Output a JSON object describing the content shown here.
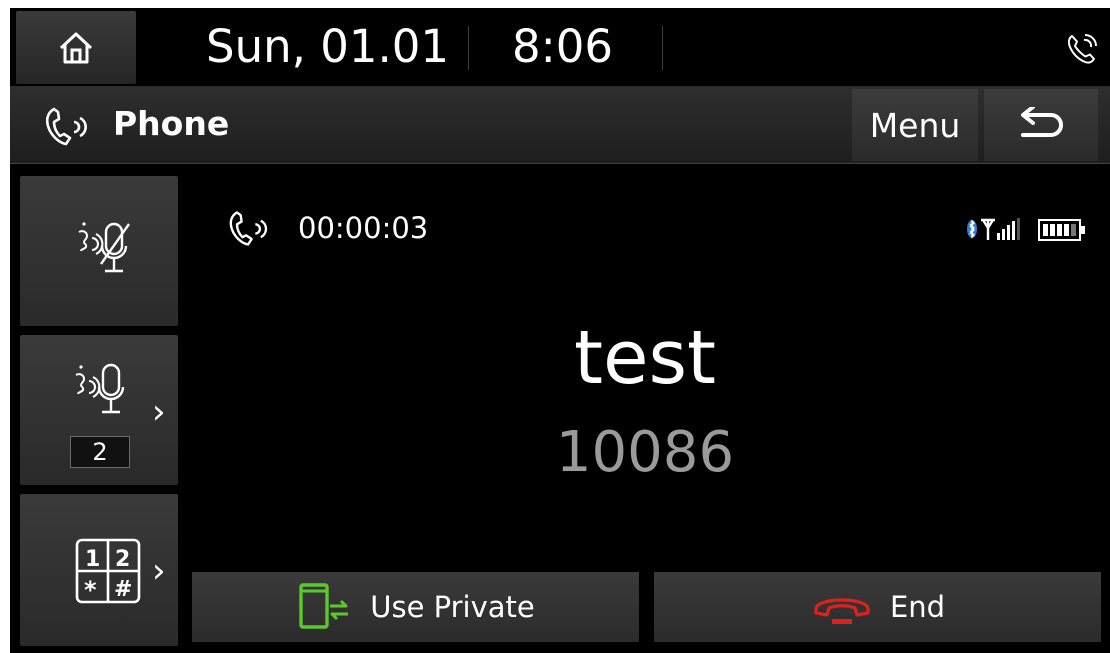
{
  "status_bar": {
    "date": "Sun, 01.01",
    "time": "8:06",
    "icons": {
      "home": "home-icon",
      "call_active": "phone-call-icon"
    }
  },
  "title_bar": {
    "title": "Phone",
    "menu_label": "Menu",
    "icons": {
      "app": "phone-handset-icon",
      "back": "back-arrow-icon"
    }
  },
  "side_controls": {
    "mute": {
      "icon": "mic-mute-icon"
    },
    "mic_volume": {
      "icon": "mic-volume-icon",
      "level": "2"
    },
    "keypad": {
      "icon": "dialpad-icon"
    }
  },
  "call": {
    "duration": "00:00:03",
    "contact_name": "test",
    "contact_number": "10086",
    "icons": {
      "call": "phone-handset-icon",
      "bluetooth": "bluetooth-signal-icon",
      "battery": "battery-icon"
    }
  },
  "actions": {
    "use_private_label": "Use Private",
    "end_label": "End",
    "use_private_color": "#5cc82e",
    "end_color": "#e0201c"
  }
}
